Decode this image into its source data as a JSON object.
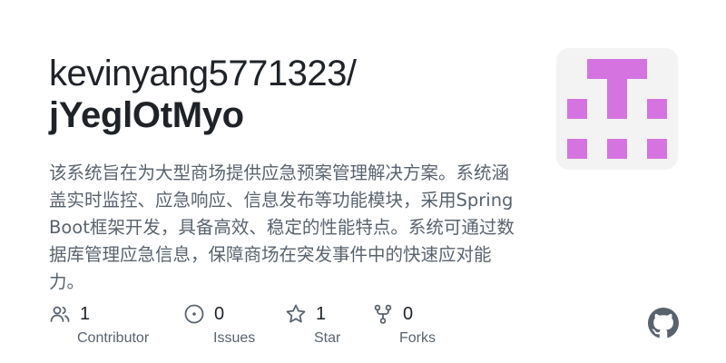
{
  "repo": {
    "owner": "kevinyang5771323/",
    "name": "jYeglOtMyo",
    "description": "该系统旨在为大型商场提供应急预案管理解决方案。系统涵盖实时监控、应急响应、信息发布等功能模块，采用Spring Boot框架开发，具备高效、稳定的性能特点。系统可通过数据库管理应急信息，保障商场在突发事件中的快速应对能力。"
  },
  "avatar": {
    "icon": "identicon",
    "color": "#d574e0",
    "background": "#f3f3f3"
  },
  "stats": {
    "contributors": {
      "count": "1",
      "label": "Contributor",
      "icon": "people-icon"
    },
    "issues": {
      "count": "0",
      "label": "Issues",
      "icon": "issue-opened-icon"
    },
    "stars": {
      "count": "1",
      "label": "Star",
      "icon": "star-icon"
    },
    "forks": {
      "count": "0",
      "label": "Forks",
      "icon": "repo-forked-icon"
    }
  },
  "brand": {
    "icon": "github-mark-icon",
    "color": "#59636e"
  }
}
